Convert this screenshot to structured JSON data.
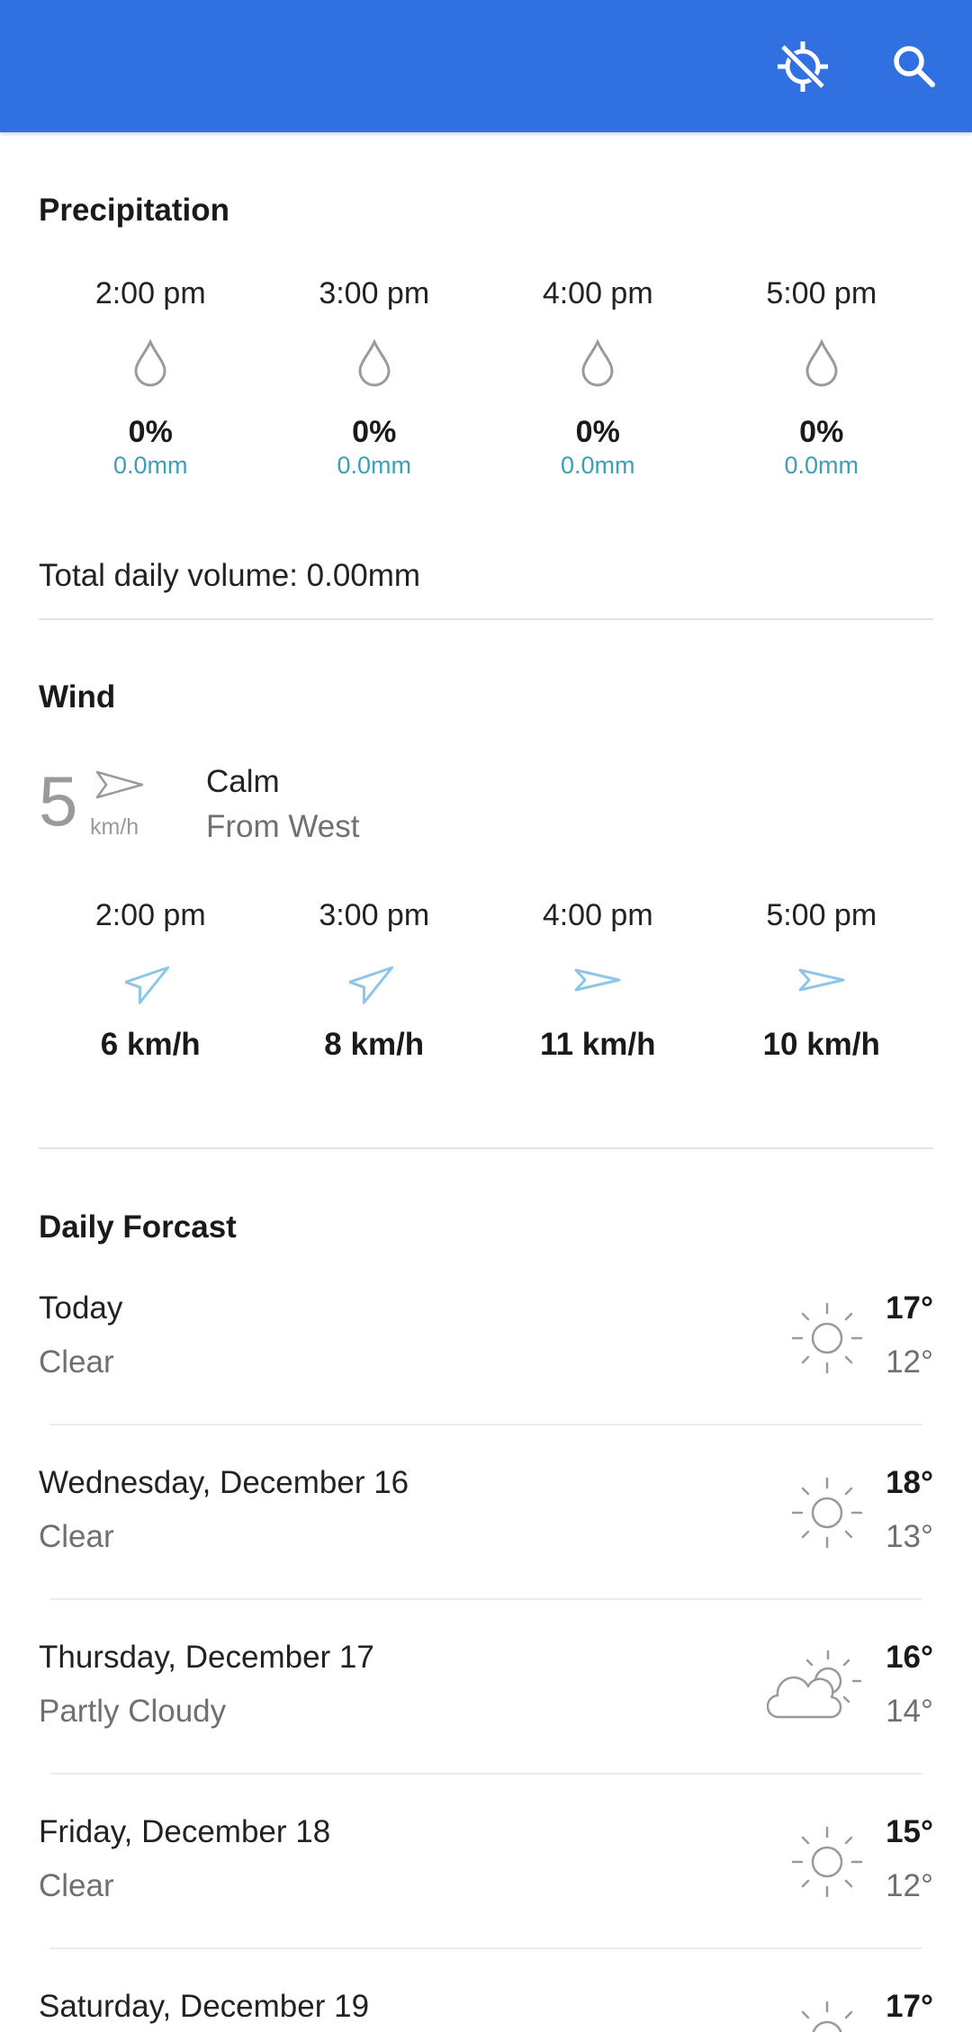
{
  "colors": {
    "appbar": "#3170e0",
    "accent_text": "#3a9fb8",
    "wind_arrow": "#8ec6ea",
    "icon_gray": "#9a9a9a"
  },
  "appbar": {
    "location_icon": "location-disabled-icon",
    "search_icon": "search-icon"
  },
  "precipitation": {
    "title": "Precipitation",
    "hours": [
      {
        "time": "2:00 pm",
        "percent": "0%",
        "amount": "0.0mm",
        "icon": "raindrop-icon"
      },
      {
        "time": "3:00 pm",
        "percent": "0%",
        "amount": "0.0mm",
        "icon": "raindrop-icon"
      },
      {
        "time": "4:00 pm",
        "percent": "0%",
        "amount": "0.0mm",
        "icon": "raindrop-icon"
      },
      {
        "time": "5:00 pm",
        "percent": "0%",
        "amount": "0.0mm",
        "icon": "raindrop-icon"
      }
    ],
    "total": "Total daily volume: 0.00mm"
  },
  "wind": {
    "title": "Wind",
    "current_speed": "5",
    "current_unit": "km/h",
    "condition": "Calm",
    "direction": "From West",
    "hours": [
      {
        "time": "2:00 pm",
        "speed": "6 km/h",
        "icon": "wind-direction-arrow-icon"
      },
      {
        "time": "3:00 pm",
        "speed": "8 km/h",
        "icon": "wind-direction-arrow-icon"
      },
      {
        "time": "4:00 pm",
        "speed": "11 km/h",
        "icon": "wind-direction-arrow-icon"
      },
      {
        "time": "5:00 pm",
        "speed": "10 km/h",
        "icon": "wind-direction-arrow-icon"
      }
    ]
  },
  "daily": {
    "title": "Daily Forcast",
    "days": [
      {
        "name": "Today",
        "condition": "Clear",
        "high": "17°",
        "low": "12°",
        "icon": "sun-icon"
      },
      {
        "name": "Wednesday, December 16",
        "condition": "Clear",
        "high": "18°",
        "low": "13°",
        "icon": "sun-icon"
      },
      {
        "name": "Thursday, December 17",
        "condition": "Partly Cloudy",
        "high": "16°",
        "low": "14°",
        "icon": "partly-cloudy-icon"
      },
      {
        "name": "Friday, December 18",
        "condition": "Clear",
        "high": "15°",
        "low": "12°",
        "icon": "sun-icon"
      },
      {
        "name": "Saturday, December 19",
        "condition": "",
        "high": "17°",
        "low": "",
        "icon": "sun-icon"
      }
    ]
  }
}
